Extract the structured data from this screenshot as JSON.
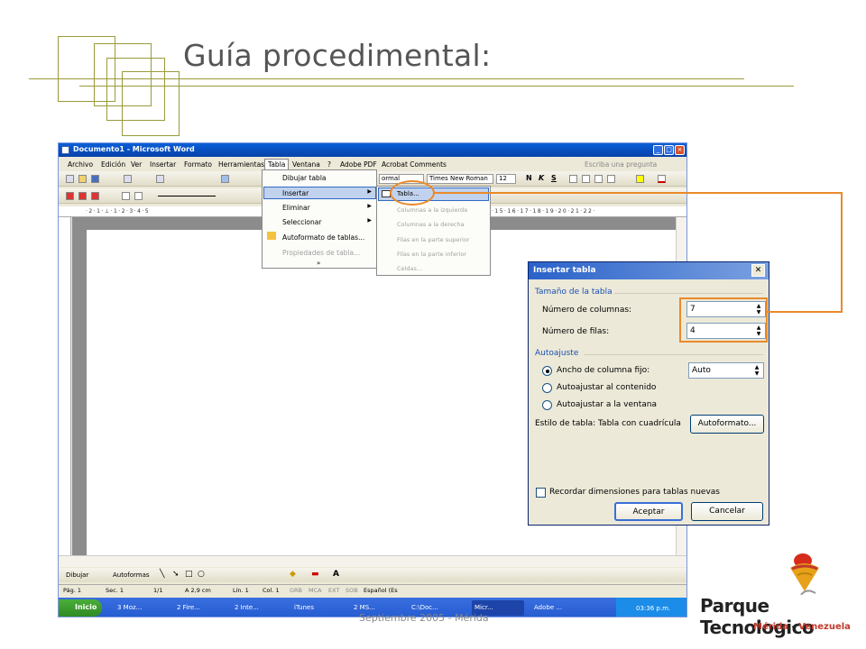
{
  "slide": {
    "title": "Guía procedimental:",
    "footer": "Septiembre 2005 - Mérida"
  },
  "word": {
    "window_title": "Documento1 - Microsoft Word",
    "menu": [
      "Archivo",
      "Edición",
      "Ver",
      "Insertar",
      "Formato",
      "Herramientas",
      "Tabla",
      "Ventana",
      "?",
      "Adobe PDF",
      "Acrobat Comments"
    ],
    "ask_question": "Escriba una pregunta",
    "style_value": "ormal",
    "font_value": "Times New Roman",
    "size_value": "12",
    "status": [
      "Pág. 1",
      "Sec. 1",
      "1/1",
      "A 2,9 cm",
      "Lín. 1",
      "Col. 1",
      "GRB",
      "MCA",
      "EXT",
      "SOB",
      "Español (Es"
    ],
    "draw_label": "Dibujar",
    "autoshapes_label": "Autoformas"
  },
  "tabla_menu": {
    "items": [
      "Dibujar tabla",
      "Insertar",
      "Eliminar",
      "Seleccionar",
      "Autoformato de tablas...",
      "Propiedades de tabla..."
    ],
    "more": "»"
  },
  "insertar_submenu": {
    "items": [
      "Tabla...",
      "Columnas a la izquierda",
      "Columnas a la derecha",
      "Filas en la parte superior",
      "Filas en la parte inferior",
      "Celdas..."
    ]
  },
  "dialog": {
    "title": "Insertar tabla",
    "size_group": "Tamaño de la tabla",
    "columns_label": "Número de columnas:",
    "columns_value": "7",
    "rows_label": "Número de filas:",
    "rows_value": "4",
    "autofit_group": "Autoajuste",
    "fixed_width_label": "Ancho de columna fijo:",
    "fixed_width_value": "Auto",
    "fit_contents_label": "Autoajustar al contenido",
    "fit_window_label": "Autoajustar a la ventana",
    "table_style_label": "Estilo de tabla: Tabla con cuadrícula",
    "autoformat_button": "Autoformato...",
    "remember_label": "Recordar dimensiones para tablas nuevas",
    "ok_button": "Aceptar",
    "cancel_button": "Cancelar"
  },
  "taskbar": {
    "start": "Inicio",
    "tasks": [
      "3 Moz...",
      "2 Fire...",
      "2 Inte...",
      "iTunes",
      "2 MS...",
      "C:\\Doc...",
      "Micr...",
      "Adobe ..."
    ],
    "clock": "03:36 p.m."
  },
  "logo": {
    "name": "Parque Tecnologico",
    "city": "Mérida",
    "sep": " - ",
    "country": "Venezuela"
  }
}
